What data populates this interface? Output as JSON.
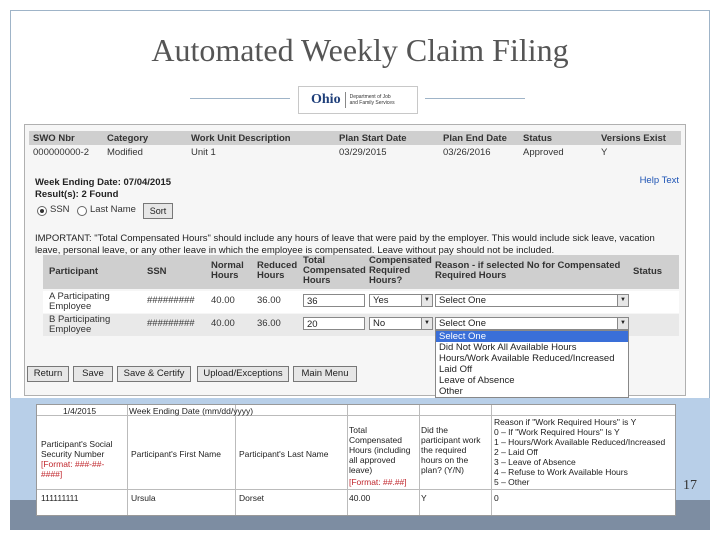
{
  "slide": {
    "title": "Automated Weekly Claim Filing",
    "page_number": "17",
    "logo": {
      "brand": "Ohio",
      "department": "Department of Job and Family Services"
    }
  },
  "swo_table": {
    "headers": [
      "SWO Nbr",
      "Category",
      "Work Unit Description",
      "Plan Start Date",
      "Plan End Date",
      "Status",
      "Versions Exist"
    ],
    "row": [
      "000000000-2",
      "Modified",
      "Unit 1",
      "03/29/2015",
      "03/26/2016",
      "Approved",
      "Y"
    ]
  },
  "week_ending": "Week Ending Date: 07/04/2015",
  "results": "Result(s): 2 Found",
  "sort": {
    "options": [
      "SSN",
      "Last Name"
    ],
    "selected": "SSN",
    "button": "Sort"
  },
  "help_text": "Help Text",
  "important": "IMPORTANT: \"Total Compensated Hours\" should include any hours of leave that were paid by the employer. This would include sick leave, vacation leave, personal leave, or any other leave in which the employee is compensated. Leave without pay should not be included.",
  "participants": {
    "headers": [
      "Participant",
      "SSN",
      "Normal Hours",
      "Reduced Hours",
      "Total Compensated Hours",
      "Compensated Required Hours?",
      "Reason - if selected No for Compensated Required Hours",
      "Status"
    ],
    "rows": [
      {
        "name": "A Participating Employee",
        "ssn": "#########",
        "normal": "40.00",
        "reduced": "36.00",
        "total": "36",
        "required": "Yes",
        "reason": "Select One"
      },
      {
        "name": "B Participating Employee",
        "ssn": "#########",
        "normal": "40.00",
        "reduced": "36.00",
        "total": "20",
        "required": "No",
        "reason": "Select One"
      }
    ]
  },
  "reason_dropdown": [
    "Select One",
    "Did Not Work All Available Hours",
    "Hours/Work Available Reduced/Increased",
    "Laid Off",
    "Leave of Absence",
    "Other"
  ],
  "buttons": [
    "Return",
    "Save",
    "Save & Certify",
    "Upload/Exceptions",
    "Main Menu"
  ],
  "csv": {
    "week_label": "Week Ending Date (mm/dd/yyyy)",
    "week_value": "1/4/2015",
    "col1": "Participant's Social Security Number",
    "col1_format": "[Format: ###-##-####]",
    "col2": "Participant's First Name",
    "col3": "Participant's Last Name",
    "col4": "Total Compensated Hours (including all approved leave)",
    "col4_format": "[Format: ##.##]",
    "col5": "Did the participant work the required hours on the plan? (Y/N)",
    "col6_lines": [
      "Reason if \"Work Required Hours\" is Y",
      "0 – If \"Work Required Hours\" Is Y",
      "1 – Hours/Work Available Reduced/Increased",
      "2 – Laid Off",
      "3 – Leave of Absence",
      "4 – Refuse to Work Available Hours",
      "5 – Other"
    ],
    "data_row": [
      "111111111",
      "Ursula",
      "Dorset",
      "40.00",
      "Y",
      "0"
    ]
  }
}
